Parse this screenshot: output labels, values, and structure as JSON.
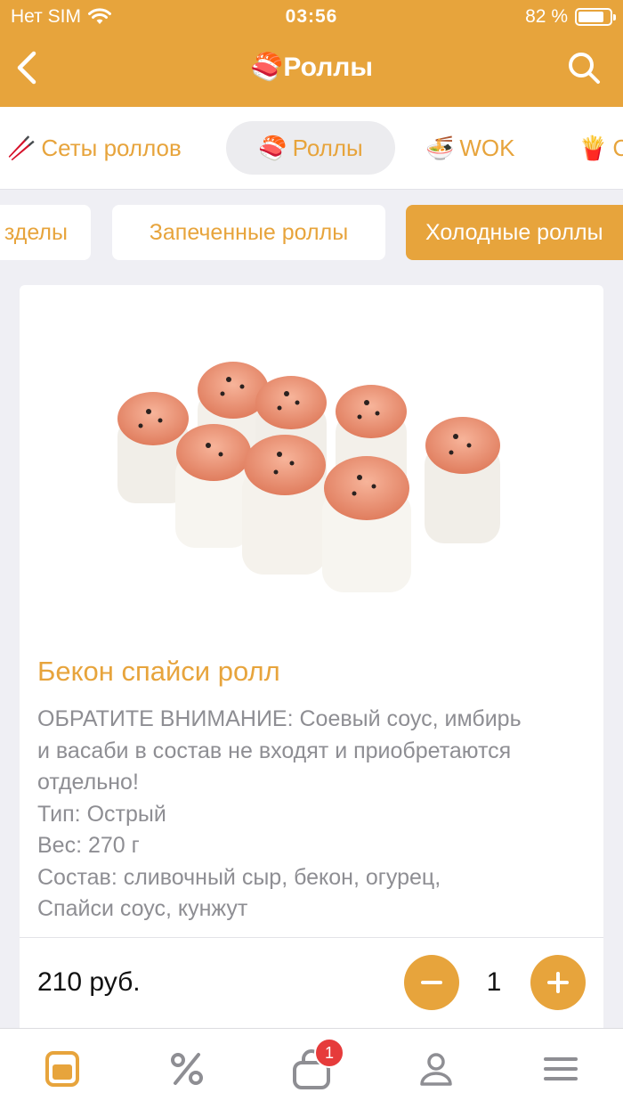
{
  "status": {
    "carrier": "Нет SIM",
    "time": "03:56",
    "battery": "82 %",
    "battery_level": 0.82
  },
  "header": {
    "title": "🍣Роллы",
    "back_icon": "chevron-left-icon",
    "search_icon": "search-icon"
  },
  "categories": [
    {
      "emoji": "🥢",
      "label": "Сеты роллов",
      "active": false
    },
    {
      "emoji": "🍣",
      "label": "Роллы",
      "active": true
    },
    {
      "emoji": "🍜",
      "label": "WOK",
      "active": false
    },
    {
      "emoji": "🍟",
      "label": "С",
      "active": false
    }
  ],
  "subcategories": [
    {
      "label": "зделы",
      "active": false
    },
    {
      "label": "Запеченные роллы",
      "active": false
    },
    {
      "label": "Холодные роллы",
      "active": true
    }
  ],
  "product": {
    "name": "Бекон спайси ролл",
    "description_lines": [
      "ОБРАТИТЕ ВНИМАНИЕ: Соевый соус, имбирь",
      "и васаби в состав не входят и приобретаются",
      "отдельно!",
      "Тип: Острый",
      "Вес: 270 г",
      "Состав: сливочный сыр, бекон, огурец,",
      "Спайси соус, кунжут"
    ],
    "price": "210 руб.",
    "quantity": "1"
  },
  "tabbar": {
    "items": [
      "menu-icon",
      "discount-icon",
      "cart-icon",
      "profile-icon",
      "hamburger-icon"
    ],
    "cart_badge": "1"
  },
  "colors": {
    "accent": "#e7a43c",
    "background": "#efeff4",
    "text_muted": "#8e8e93",
    "badge": "#e63b3b"
  }
}
